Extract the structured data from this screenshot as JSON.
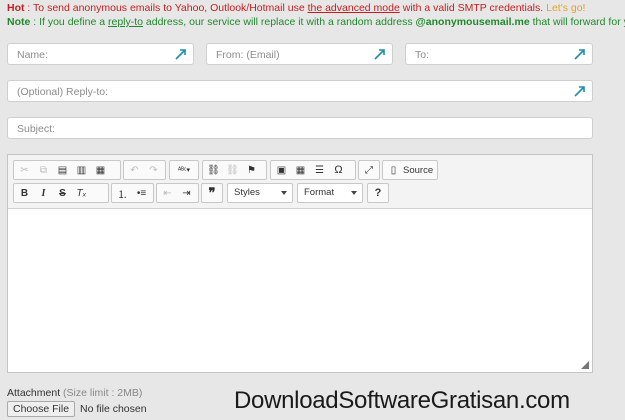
{
  "notices": {
    "hot_label": "Hot",
    "hot_text1": " : To send anonymous emails to Yahoo, Outlook/Hotmail use ",
    "hot_link": "the advanced mode",
    "hot_text2": " with a valid SMTP credentials. ",
    "hot_go": "Let's go!",
    "note_label": "Note",
    "note_text1": " : If you define a ",
    "note_link": "reply-to",
    "note_text2": " address, our service will replace it with a random address ",
    "note_email": "@anonymousemail.me",
    "note_text3": " that will forward for yo"
  },
  "form": {
    "name_placeholder": "Name:",
    "from_placeholder": "From: (Email)",
    "to_placeholder": "To:",
    "replyto_placeholder": "(Optional) Reply-to:",
    "subject_placeholder": "Subject:"
  },
  "toolbar": {
    "source_label": "Source",
    "styles_label": "Styles",
    "format_label": "Format",
    "help_label": "?"
  },
  "attachment": {
    "label": "Attachment",
    "limit": "(Size limit : 2MB)",
    "choose_label": "Choose File",
    "no_file": "No file chosen"
  },
  "watermark": "DownloadSoftwareGratisan.com",
  "colors": {
    "hot": "#c41e1e",
    "note": "#1f8a2a",
    "go": "#e8a028",
    "pin": "#1a8fb0"
  }
}
